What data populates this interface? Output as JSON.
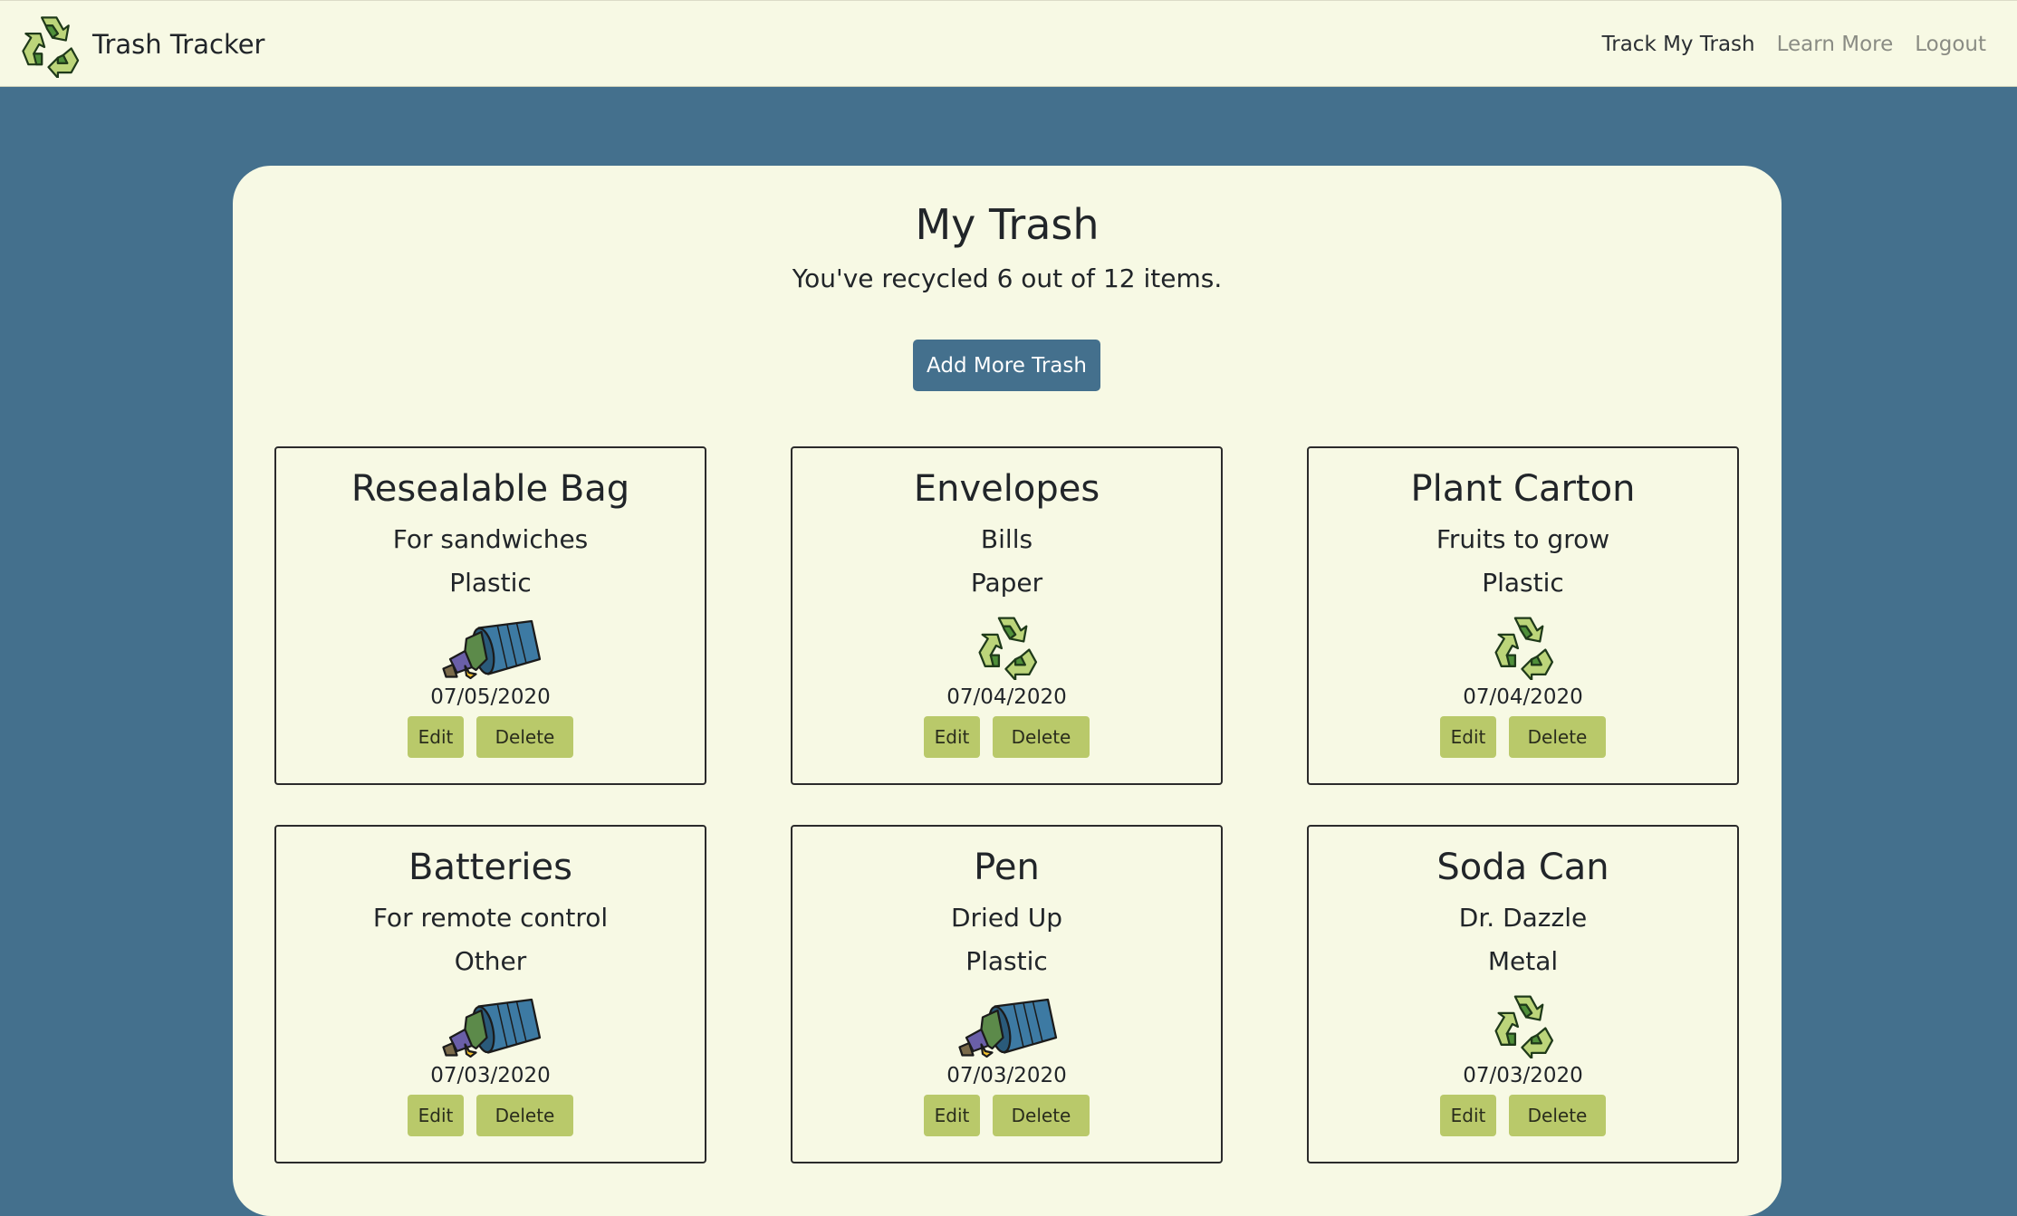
{
  "navbar": {
    "brand": "Trash Tracker",
    "brand_icon": "recycle-icon",
    "links": [
      {
        "label": "Track My Trash",
        "active": true
      },
      {
        "label": "Learn More",
        "active": false
      },
      {
        "label": "Logout",
        "active": false
      }
    ]
  },
  "main": {
    "title": "My Trash",
    "summary": "You've recycled 6 out of 12 items.",
    "add_button": "Add More Trash"
  },
  "items": [
    {
      "name": "Resealable Bag",
      "description": "For sandwiches",
      "type": "Plastic",
      "status_icon": "trash-can-icon",
      "date": "07/05/2020",
      "edit_label": "Edit",
      "delete_label": "Delete"
    },
    {
      "name": "Envelopes",
      "description": "Bills",
      "type": "Paper",
      "status_icon": "recycle-icon",
      "date": "07/04/2020",
      "edit_label": "Edit",
      "delete_label": "Delete"
    },
    {
      "name": "Plant Carton",
      "description": "Fruits to grow",
      "type": "Plastic",
      "status_icon": "recycle-icon",
      "date": "07/04/2020",
      "edit_label": "Edit",
      "delete_label": "Delete"
    },
    {
      "name": "Batteries",
      "description": "For remote control",
      "type": "Other",
      "status_icon": "trash-can-icon",
      "date": "07/03/2020",
      "edit_label": "Edit",
      "delete_label": "Delete"
    },
    {
      "name": "Pen",
      "description": "Dried Up",
      "type": "Plastic",
      "status_icon": "trash-can-icon",
      "date": "07/03/2020",
      "edit_label": "Edit",
      "delete_label": "Delete"
    },
    {
      "name": "Soda Can",
      "description": "Dr. Dazzle",
      "type": "Metal",
      "status_icon": "recycle-icon",
      "date": "07/03/2020",
      "edit_label": "Edit",
      "delete_label": "Delete"
    }
  ],
  "colors": {
    "background": "#44708d",
    "card": "#f7f9e4",
    "accent_button": "#44708d",
    "action_button": "#b9c96a"
  }
}
